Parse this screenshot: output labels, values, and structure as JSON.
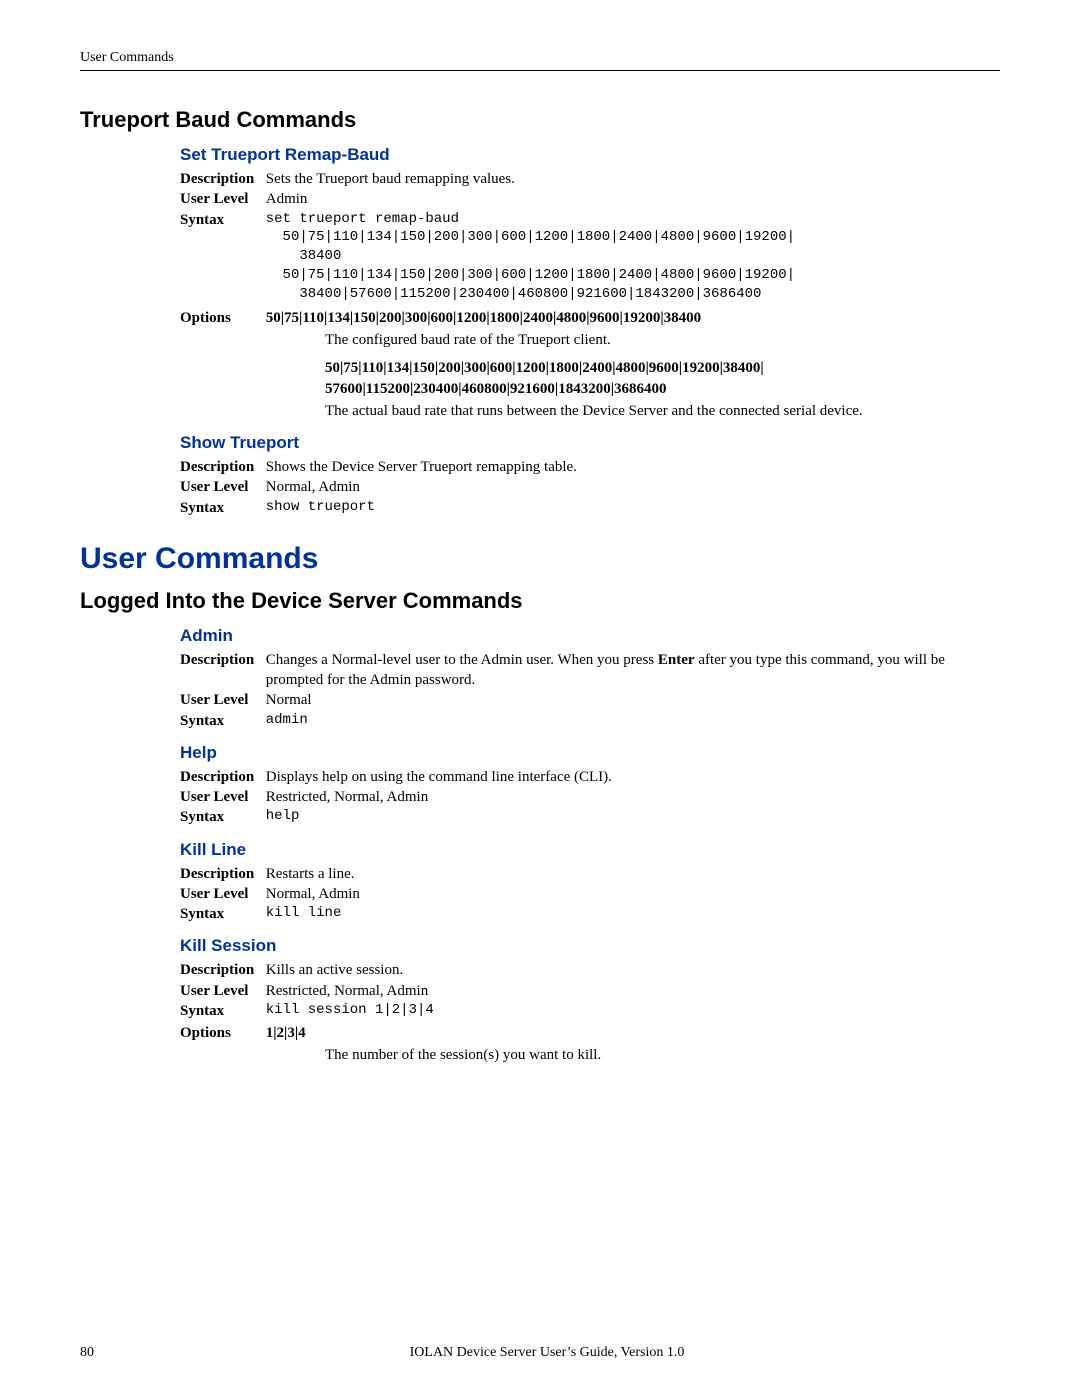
{
  "page_header": "User Commands",
  "sect_trueport_baud": "Trueport Baud Commands",
  "sub_set_trueport": "Set Trueport Remap-Baud",
  "labels": {
    "description": "Description",
    "user_level": "User Level",
    "syntax": "Syntax",
    "options": "Options"
  },
  "set_trueport": {
    "description": "Sets the Trueport baud remapping values.",
    "user_level": "Admin",
    "syntax_line1": "set trueport remap-baud",
    "syntax_line2": "  50|75|110|134|150|200|300|600|1200|1800|2400|4800|9600|19200|",
    "syntax_line3": "    38400",
    "syntax_line4": "  50|75|110|134|150|200|300|600|1200|1800|2400|4800|9600|19200|",
    "syntax_line5": "    38400|57600|115200|230400|460800|921600|1843200|3686400",
    "options_head1": "50|75|110|134|150|200|300|600|1200|1800|2400|4800|9600|19200|38400",
    "options_body1": "The configured baud rate of the Trueport client.",
    "options_head2a": "50|75|110|134|150|200|300|600|1200|1800|2400|4800|9600|19200|38400|",
    "options_head2b": "57600|115200|230400|460800|921600|1843200|3686400",
    "options_body2": "The actual baud rate that runs between the Device Server and the connected serial device."
  },
  "sub_show_trueport": "Show Trueport",
  "show_trueport": {
    "description": "Shows the Device Server Trueport remapping table.",
    "user_level": "Normal, Admin",
    "syntax": "show trueport"
  },
  "chap_user_commands": "User Commands",
  "sect_logged_in": "Logged Into the Device Server Commands",
  "sub_admin": "Admin",
  "admin": {
    "description_pre": "Changes a Normal-level user to the Admin user. When you press ",
    "description_bold": "Enter",
    "description_post": " after you type this command, you will be prompted for the Admin password.",
    "user_level": "Normal",
    "syntax": "admin"
  },
  "sub_help": "Help",
  "help": {
    "description": "Displays help on using the command line interface (CLI).",
    "user_level": "Restricted, Normal, Admin",
    "syntax": "help"
  },
  "sub_kill_line": "Kill Line",
  "kill_line": {
    "description": "Restarts a line.",
    "user_level": "Normal, Admin",
    "syntax": "kill line"
  },
  "sub_kill_session": "Kill Session",
  "kill_session": {
    "description": "Kills an active session.",
    "user_level": "Restricted, Normal, Admin",
    "syntax": "kill session 1|2|3|4",
    "options_head": "1|2|3|4",
    "options_body": "The number of the session(s) you want to kill."
  },
  "footer": {
    "page_number": "80",
    "text": "IOLAN Device Server User’s Guide, Version 1.0"
  }
}
